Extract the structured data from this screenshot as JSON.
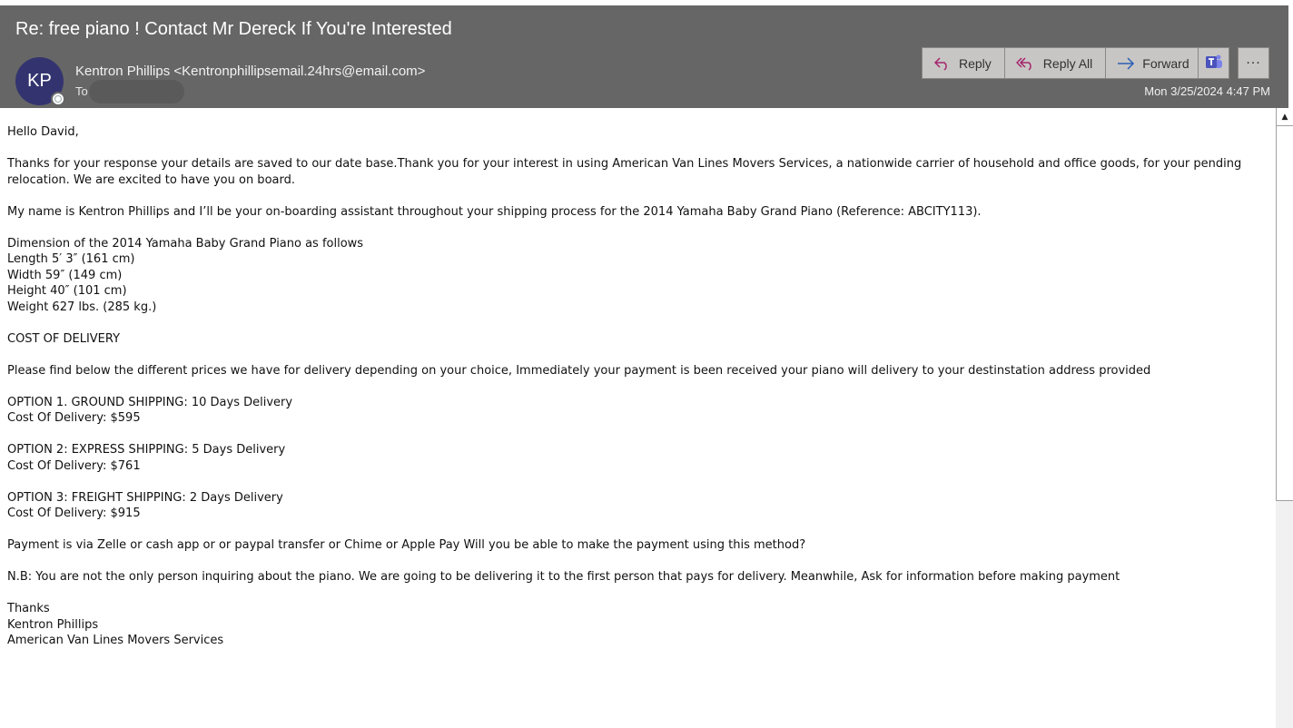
{
  "header": {
    "subject": "Re: free piano ! Contact Mr Dereck If You're Interested",
    "avatar_initials": "KP",
    "sender": "Kentron Phillips <Kentronphillipsemail.24hrs@email.com>",
    "to_label": "To",
    "date": "Mon 3/25/2024 4:47 PM",
    "colors": {
      "header_bg": "#666666",
      "avatar_bg": "#33346f",
      "reply_icon": "#a4266e",
      "forward_icon": "#2b5fb5"
    }
  },
  "actions": {
    "reply": "Reply",
    "reply_all": "Reply All",
    "forward": "Forward",
    "teams_icon": "teams-icon",
    "more": "···"
  },
  "body": {
    "paragraphs": [
      "Hello David,",
      "Thanks for your response your details are saved to our date base.Thank you for your interest in using American Van Lines Movers Services, a nationwide carrier of household and office goods, for your pending relocation. We are excited to have you on board.",
      "My name is Kentron Phillips and I’ll be your on-boarding assistant throughout your shipping process for the 2014 Yamaha Baby Grand Piano (Reference: ABCITY113).",
      "Dimension of the 2014 Yamaha Baby Grand Piano as follows\nLength 5′ 3″ (161 cm)\nWidth 59″ (149 cm)\nHeight 40″ (101 cm)\nWeight 627 lbs. (285 kg.)",
      "COST OF DELIVERY",
      "Please find below the different prices we have for delivery depending on your choice, Immediately your payment is been received your piano will delivery to your destinstation address provided",
      "OPTION 1. GROUND SHIPPING: 10 Days Delivery\nCost Of Delivery: $595",
      "OPTION 2: EXPRESS SHIPPING: 5 Days Delivery\nCost Of Delivery: $761",
      "OPTION 3: FREIGHT SHIPPING: 2 Days Delivery\nCost Of Delivery: $915",
      "Payment is via Zelle or cash app or or paypal transfer or Chime or Apple Pay Will you be able to make the payment using this method?",
      "N.B: You are not the only person inquiring about the piano. We are going to be delivering it to the first person that pays for delivery. Meanwhile, Ask for information before making payment",
      "Thanks\nKentron Phillips\nAmerican Van Lines Movers Services"
    ]
  },
  "scrollbar": {
    "up_arrow": "▲"
  }
}
